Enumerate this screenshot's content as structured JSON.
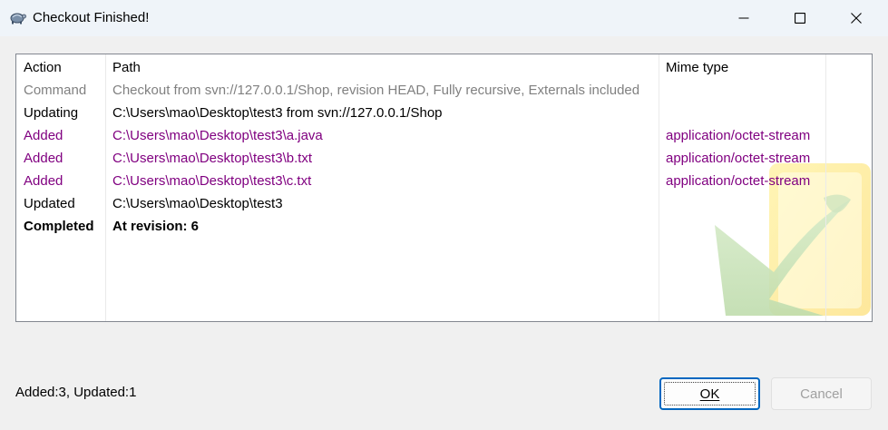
{
  "window": {
    "title": "Checkout Finished!",
    "app_icon": "tortoise-icon",
    "controls": [
      "minimize-icon",
      "maximize-icon",
      "close-icon"
    ]
  },
  "list": {
    "columns": [
      "Action",
      "Path",
      "Mime type"
    ],
    "rows": [
      {
        "action": "Command",
        "path": "Checkout from svn://127.0.0.1/Shop, revision HEAD, Fully recursive, Externals included",
        "mime": "",
        "color": "#808080",
        "bold": false
      },
      {
        "action": "Updating",
        "path": "C:\\Users\\mao\\Desktop\\test3 from svn://127.0.0.1/Shop",
        "mime": "",
        "color": "#000000",
        "bold": false
      },
      {
        "action": "Added",
        "path": "C:\\Users\\mao\\Desktop\\test3\\a.java",
        "mime": "application/octet-stream",
        "color": "#800080",
        "bold": false
      },
      {
        "action": "Added",
        "path": "C:\\Users\\mao\\Desktop\\test3\\b.txt",
        "mime": "application/octet-stream",
        "color": "#800080",
        "bold": false
      },
      {
        "action": "Added",
        "path": "C:\\Users\\mao\\Desktop\\test3\\c.txt",
        "mime": "application/octet-stream",
        "color": "#800080",
        "bold": false
      },
      {
        "action": "Updated",
        "path": "C:\\Users\\mao\\Desktop\\test3",
        "mime": "",
        "color": "#000000",
        "bold": false
      },
      {
        "action": "Completed",
        "path": "At revision: 6",
        "mime": "",
        "color": "#000000",
        "bold": true
      }
    ]
  },
  "status": "Added:3, Updated:1",
  "buttons": {
    "ok": "OK",
    "cancel": "Cancel"
  }
}
